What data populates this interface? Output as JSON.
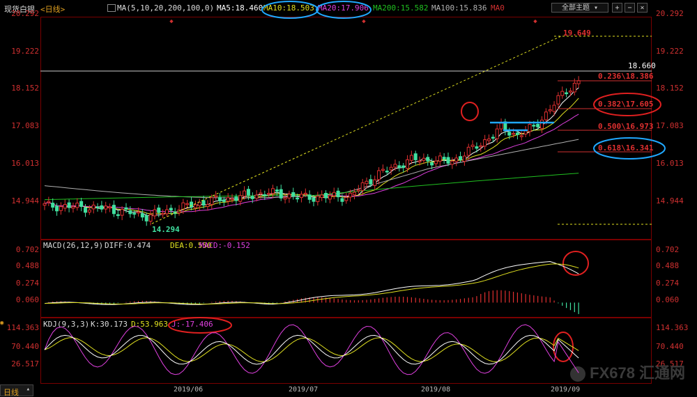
{
  "header": {
    "instrument": "现货白银",
    "period": "<日线>",
    "ma_params": "MA(5,10,20,200,100,0)",
    "ma5": "MA5:18.460",
    "ma10": "MA10:18.503",
    "ma20": "MA20:17.906",
    "ma200": "MA200:15.582",
    "ma100": "MA100:15.836",
    "ma0": "MA0",
    "theme_button": "全部主题"
  },
  "colors": {
    "ma5": "#ffffff",
    "ma10": "#e0e020",
    "ma20": "#e040e0",
    "ma200": "#20c020",
    "ma100": "#b0b0b0",
    "up": "#e03030",
    "down": "#40e0a0"
  },
  "main_axis": {
    "ticks": [
      "20.292",
      "19.222",
      "18.152",
      "17.083",
      "16.013",
      "14.944"
    ]
  },
  "annotations": {
    "high_label": "19.649",
    "low_label": "14.294",
    "hline_label": "18.660",
    "fib_236": "0.236\\18.386",
    "fib_382": "0.382\\17.605",
    "fib_500": "0.500\\16.973",
    "fib_618": "0.618\\16.341"
  },
  "macd": {
    "title": "MACD(26,12,9)",
    "diff": "DIFF:0.474",
    "dea": "DEA:0.550",
    "macd": "MACD:-0.152",
    "ticks": [
      "0.702",
      "0.488",
      "0.274",
      "0.060"
    ]
  },
  "kdj": {
    "title": "KDJ(9,3,3)",
    "k": "K:30.173",
    "d": "D:53.963",
    "j": "J:-17.406",
    "ticks": [
      "114.363",
      "70.440",
      "26.517"
    ]
  },
  "x_axis": {
    "labels": [
      "2019/06",
      "2019/07",
      "2019/08",
      "2019/09"
    ]
  },
  "footer": {
    "tab": "日线"
  },
  "watermark": "FX678 汇通网",
  "chart_data": {
    "type": "candlestick",
    "title": "现货白银",
    "ylim": [
      13.9,
      20.6
    ],
    "high": 19.649,
    "low": 14.294,
    "ma_lines": [
      "MA5",
      "MA10",
      "MA20",
      "MA200",
      "MA100"
    ]
  }
}
